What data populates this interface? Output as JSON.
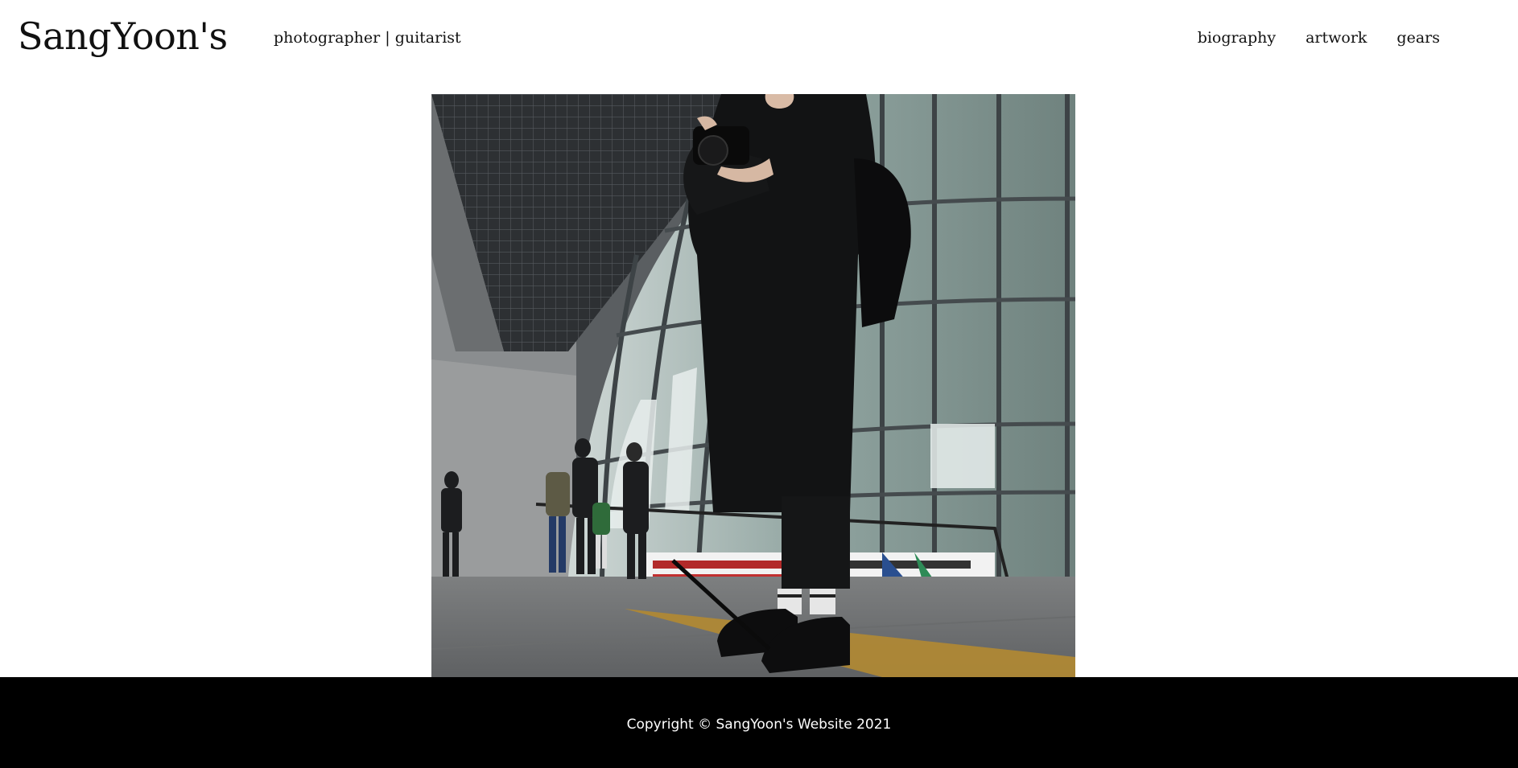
{
  "header": {
    "site_title": "SangYoon's",
    "tagline": "photographer | guitarist",
    "nav": [
      {
        "label": "biography"
      },
      {
        "label": "artwork"
      },
      {
        "label": "gears"
      }
    ]
  },
  "hero": {
    "image_subject": "street photograph of a photographer in a black coat holding a camera in front of a curved glass building"
  },
  "footer": {
    "copyright": "Copyright © SangYoon's Website 2021"
  },
  "colors": {
    "background": "#ffffff",
    "text": "#111111",
    "footer_bg": "#000000",
    "footer_text": "#ffffff"
  }
}
